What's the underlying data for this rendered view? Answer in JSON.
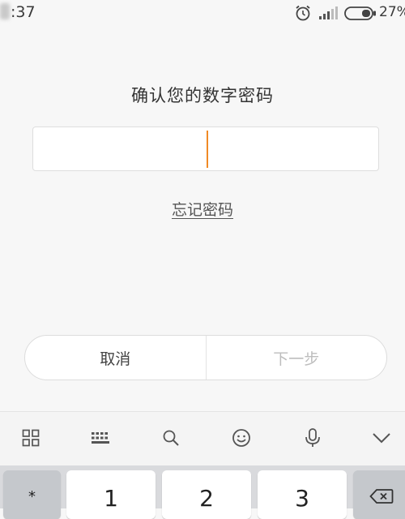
{
  "status_bar": {
    "time": ":37",
    "battery_text": "27%",
    "icons": [
      "alarm-icon",
      "signal-icon",
      "battery-icon"
    ]
  },
  "screen": {
    "title": "确认您的数字密码",
    "forgot_password": "忘记密码",
    "cancel_label": "取消",
    "next_label": "下一步"
  },
  "keyboard": {
    "toolbar_icons": [
      "grid-icon",
      "keyboard-icon",
      "search-icon",
      "emoji-icon",
      "microphone-icon",
      "chevron-down-icon"
    ],
    "keys": [
      "*",
      "1",
      "2",
      "3"
    ],
    "delete_icon": "backspace-icon"
  },
  "colors": {
    "caret": "#f08a25",
    "background": "#f7f7f7",
    "disabled_text": "#bdbdbd"
  }
}
